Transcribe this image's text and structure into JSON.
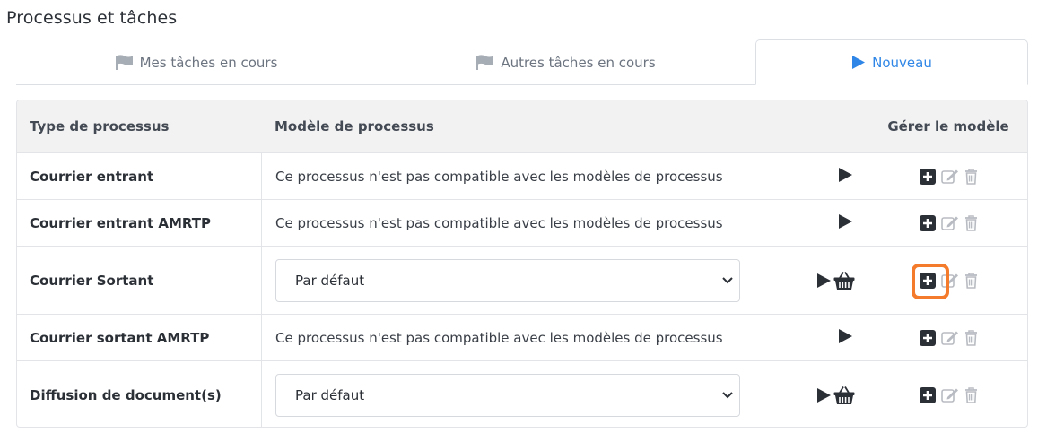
{
  "page": {
    "title": "Processus et tâches"
  },
  "tabs": [
    {
      "label": "Mes tâches en cours",
      "icon": "flag-icon",
      "active": false
    },
    {
      "label": "Autres tâches en cours",
      "icon": "flag-icon",
      "active": false
    },
    {
      "label": "Nouveau",
      "icon": "play-icon",
      "active": true
    }
  ],
  "table": {
    "headers": {
      "type": "Type de processus",
      "model": "Modèle de processus",
      "manage": "Gérer le modèle"
    },
    "rows": [
      {
        "type": "Courrier entrant",
        "model_text": "Ce processus n'est pas compatible avec les modèles de processus"
      },
      {
        "type": "Courrier entrant AMRTP",
        "model_text": "Ce processus n'est pas compatible avec les modèles de processus"
      },
      {
        "type": "Courrier Sortant",
        "model_select": "Par défaut"
      },
      {
        "type": "Courrier sortant AMRTP",
        "model_text": "Ce processus n'est pas compatible avec les modèles de processus"
      },
      {
        "type": "Diffusion de document(s)",
        "model_select": "Par défaut"
      }
    ]
  },
  "colors": {
    "accent": "#2f86e6",
    "highlight": "#f47b2c",
    "icon_dark": "#2b2f36",
    "icon_muted": "#b8bcc2"
  }
}
